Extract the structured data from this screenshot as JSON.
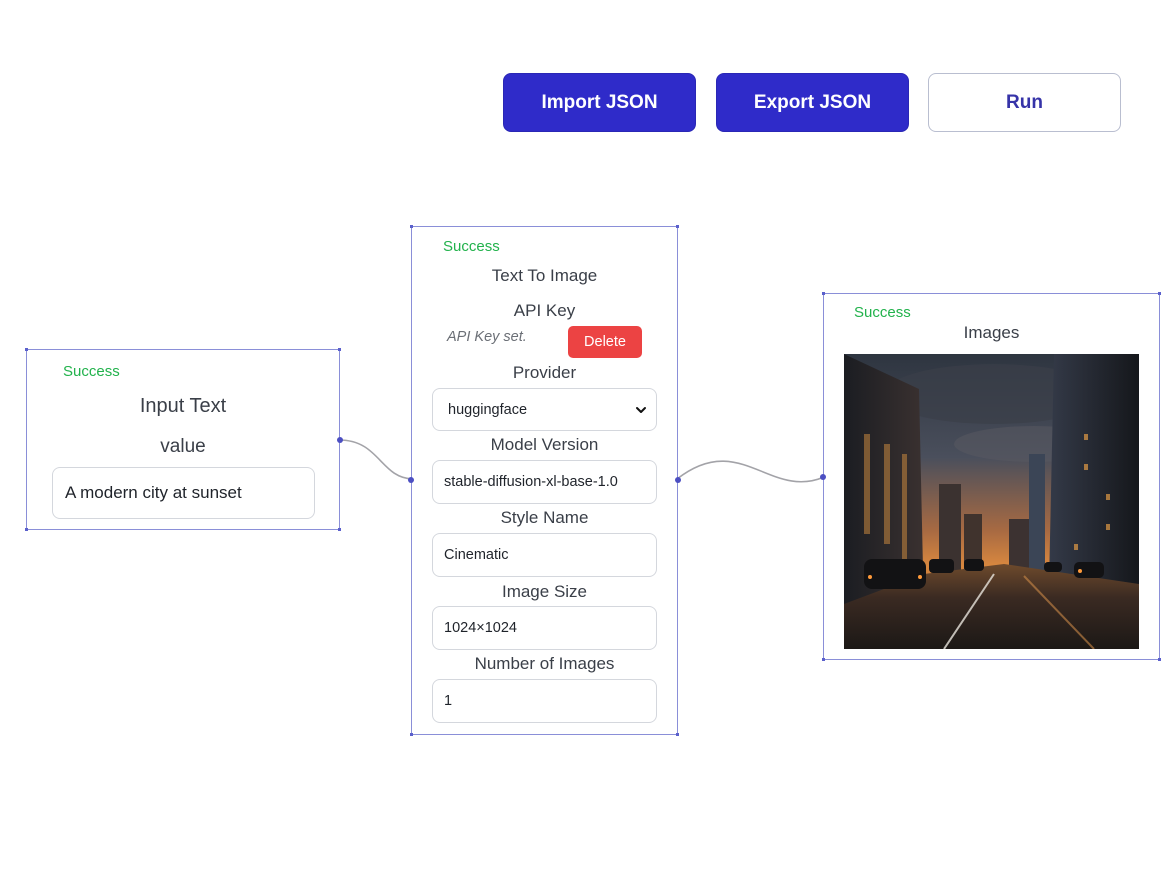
{
  "toolbar": {
    "import_label": "Import JSON",
    "export_label": "Export JSON",
    "run_label": "Run"
  },
  "nodes": {
    "input_text": {
      "status": "Success",
      "title": "Input Text",
      "field_label": "value",
      "field_value": "A modern city at sunset"
    },
    "text_to_image": {
      "status": "Success",
      "title": "Text To Image",
      "api_key_label": "API Key",
      "api_key_note": "API Key set.",
      "delete_label": "Delete",
      "provider_label": "Provider",
      "provider_value": "huggingface",
      "model_version_label": "Model Version",
      "model_version_value": "stable-diffusion-xl-base-1.0",
      "style_name_label": "Style Name",
      "style_name_value": "Cinematic",
      "image_size_label": "Image Size",
      "image_size_value": "1024×1024",
      "num_images_label": "Number of Images",
      "num_images_value": "1"
    },
    "images": {
      "status": "Success",
      "title": "Images"
    }
  },
  "colors": {
    "primary_button": "#2f2bc9",
    "status_success": "#22b24c",
    "delete_button": "#ec4343",
    "node_border": "#8a8fd8",
    "edge": "#9a9aa0"
  },
  "icons": {
    "provider_dropdown": "chevron-down-icon"
  }
}
